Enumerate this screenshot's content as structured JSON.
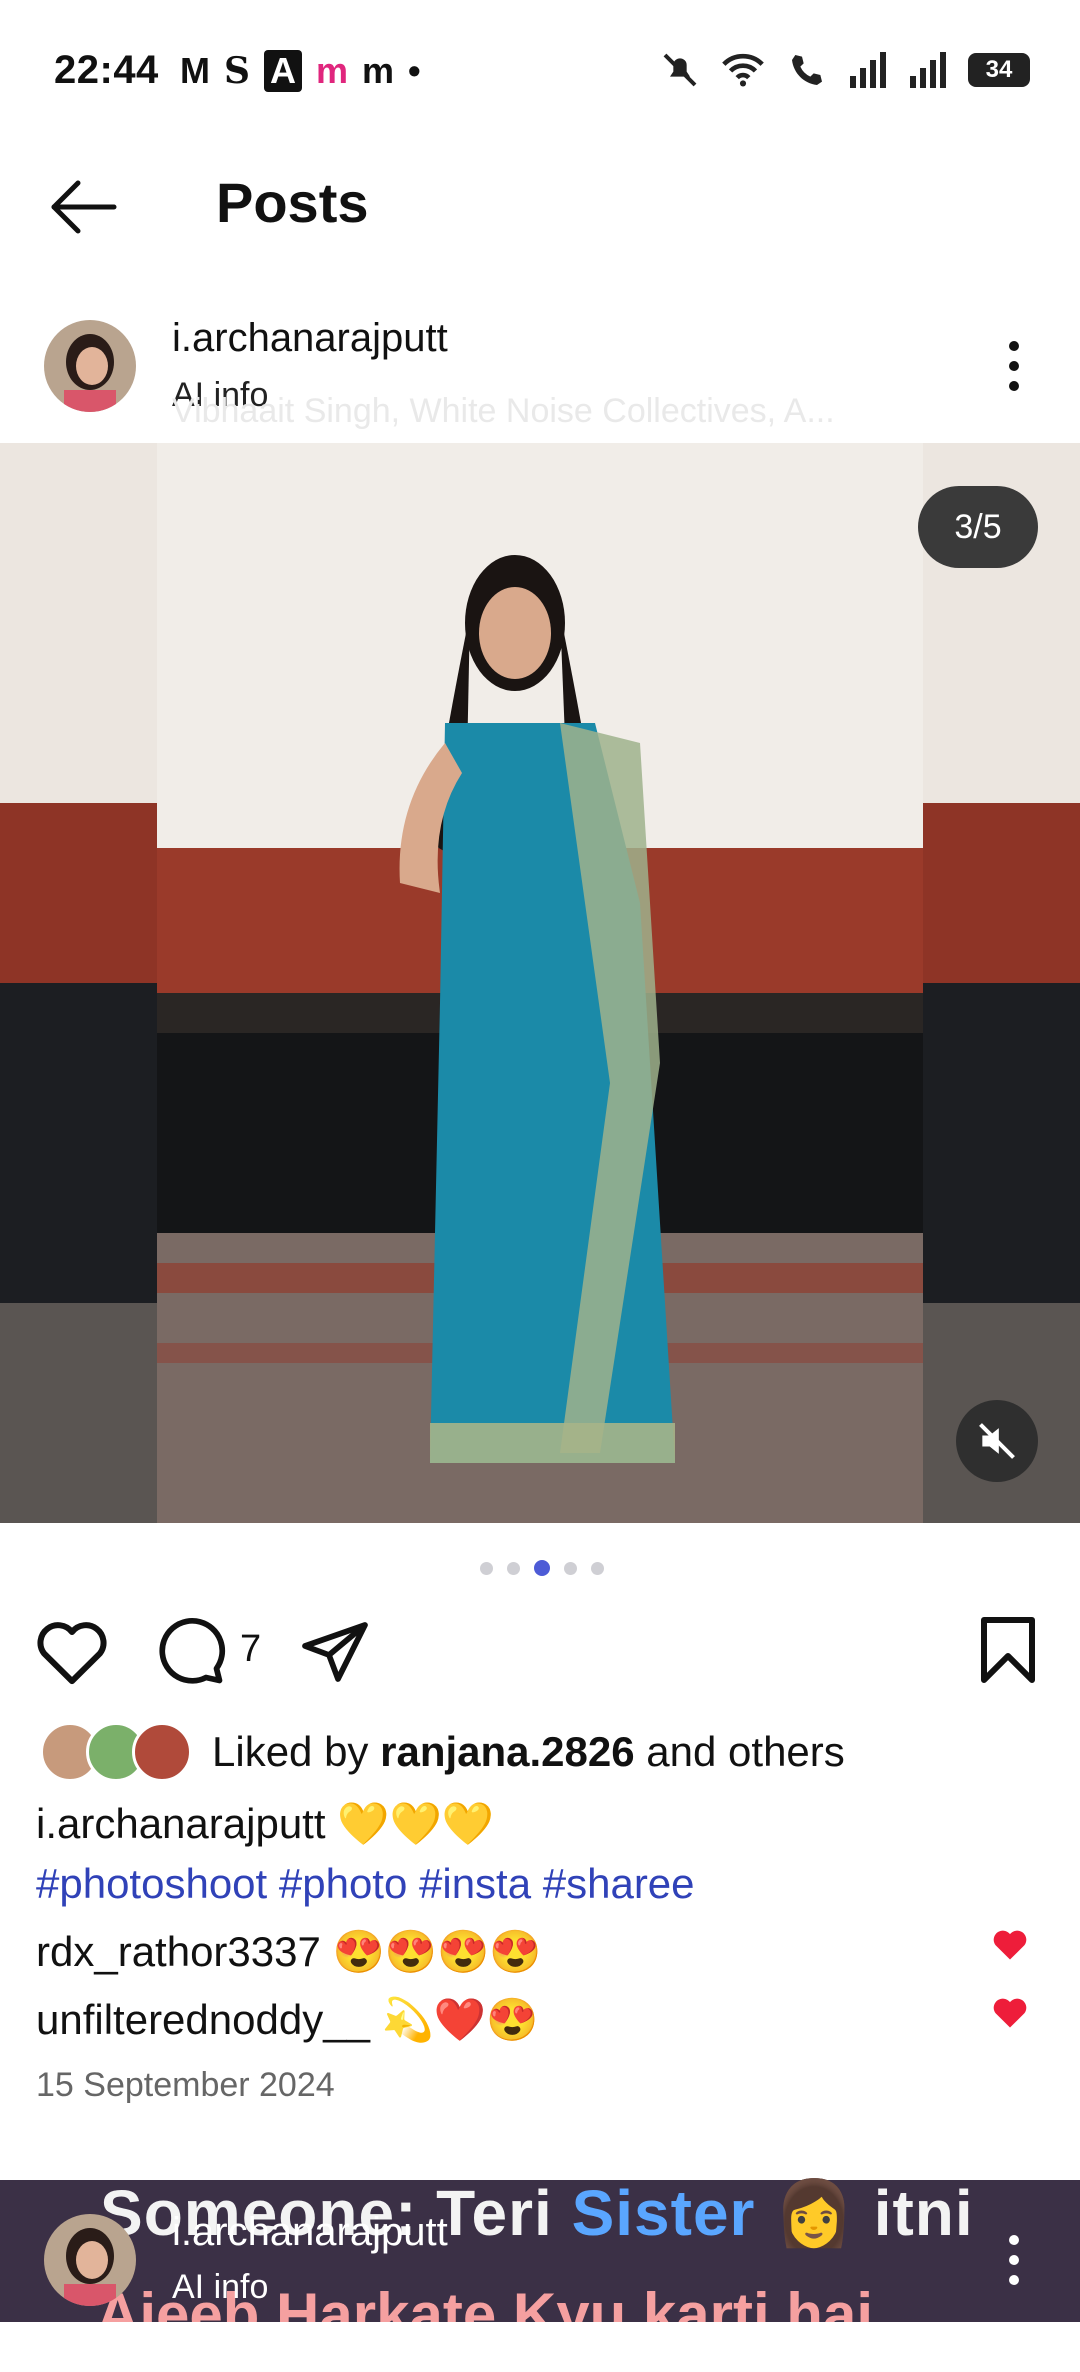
{
  "status_bar": {
    "time": "22:44",
    "notif_glyphs": [
      "M",
      "S",
      "A",
      "m",
      "m",
      "•"
    ],
    "battery": "34"
  },
  "header": {
    "title": "Posts"
  },
  "post": {
    "username": "i.archanarajputt",
    "subtitle": "AI info",
    "audio_hint": "Vibhaait Singh, White Noise Collectives, A...",
    "media_counter": "3/5",
    "carousel_total": 5,
    "carousel_active": 3,
    "comment_count": "7",
    "liked_by_prefix": "Liked by",
    "liked_by_user": "ranjana.2826",
    "liked_by_suffix": "and others",
    "caption_user": "i.archanarajputt",
    "caption_emoji": "💛💛💛",
    "hashtags": "#photoshoot #photo #insta #sharee",
    "comments": [
      {
        "user": "rdx_rathor3337",
        "text": "😍😍😍😍"
      },
      {
        "user": "unfilterednoddy__",
        "text": "💫❤️😍"
      }
    ],
    "date": "15 September 2024"
  },
  "next_post": {
    "username": "i.archanarajputt",
    "subtitle": "AI info",
    "overlay_line1_a": "Someone: Teri",
    "overlay_line1_b": "Sister",
    "overlay_line1_c": "👩 itni",
    "overlay_line2": "Ajeeb Harkate Kyu karti hai"
  },
  "colors": {
    "hashtag_blue": "#3042b8",
    "active_dot": "#4d5bd6",
    "like_red": "#ee1d3a"
  }
}
